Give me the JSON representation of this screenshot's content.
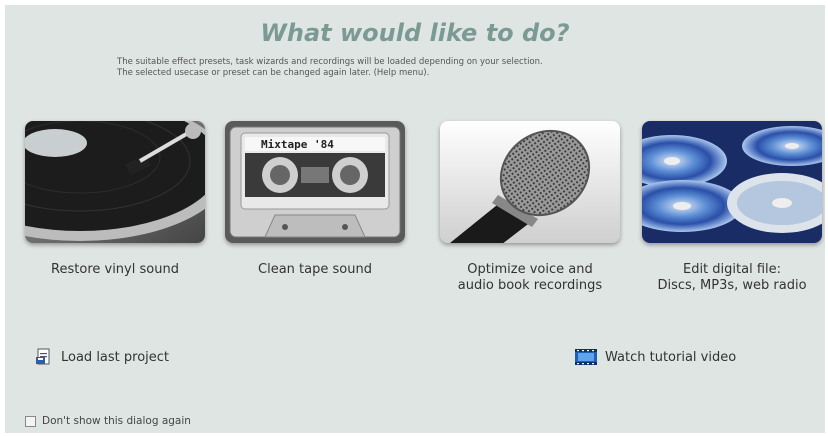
{
  "dialog": {
    "title": "What would like to do?",
    "subtitle_line1": "The suitable effect presets, task wizards and recordings will be loaded depending on your selection.",
    "subtitle_line2": "The selected usecase or preset can be changed again later. (Help menu)."
  },
  "options": [
    {
      "label_line1": "Restore vinyl sound",
      "label_line2": ""
    },
    {
      "label_line1": "Clean tape sound",
      "label_line2": "",
      "tape_label": "Mixtape '84"
    },
    {
      "label_line1": "Optimize voice and",
      "label_line2": "audio book recordings"
    },
    {
      "label_line1": "Edit digital file:",
      "label_line2": "Discs, MP3s, web radio"
    }
  ],
  "actions": {
    "load_last_project": "Load last project",
    "watch_tutorial": "Watch tutorial video"
  },
  "footer": {
    "dont_show_label": "Don't show this dialog again",
    "dont_show_checked": false
  }
}
